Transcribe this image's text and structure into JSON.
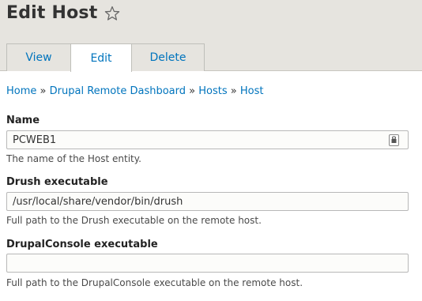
{
  "page": {
    "title": "Edit Host"
  },
  "tabs": [
    {
      "label": "View"
    },
    {
      "label": "Edit"
    },
    {
      "label": "Delete"
    }
  ],
  "breadcrumb": {
    "items": [
      "Home",
      "Drupal Remote Dashboard",
      "Hosts",
      "Host"
    ],
    "separator": "»"
  },
  "form": {
    "name": {
      "label": "Name",
      "value": "PCWEB1",
      "description": "The name of the Host entity."
    },
    "drush": {
      "label": "Drush executable",
      "value": "/usr/local/share/vendor/bin/drush",
      "description": "Full path to the Drush executable on the remote host."
    },
    "console": {
      "label": "DrupalConsole executable",
      "value": "",
      "description": "Full path to the DrupalConsole executable on the remote host."
    }
  },
  "colors": {
    "link": "#0074bd",
    "header_bg": "#e6e4df",
    "text": "#333333"
  },
  "icons": {
    "favorite": "star-outline-icon",
    "autofill": "password-manager-icon"
  }
}
